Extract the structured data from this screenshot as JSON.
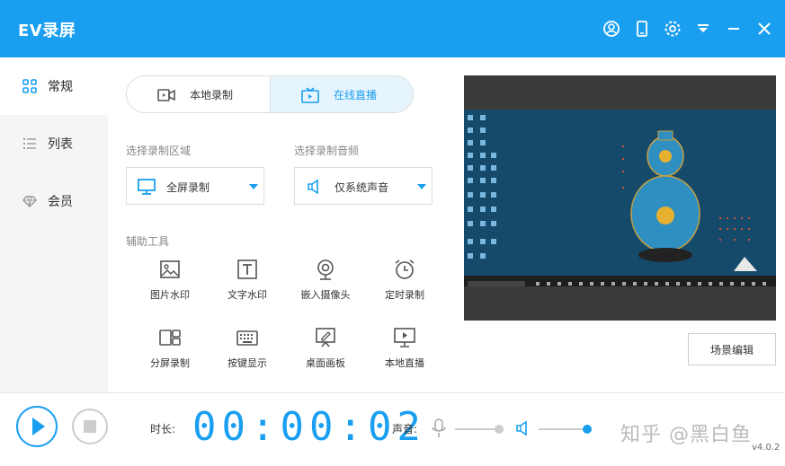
{
  "app": {
    "title": "EV录屏"
  },
  "sidebar": {
    "items": [
      {
        "label": "常规",
        "icon": "grid-icon",
        "active": true
      },
      {
        "label": "列表",
        "icon": "list-icon",
        "active": false
      },
      {
        "label": "会员",
        "icon": "diamond-icon",
        "active": false
      }
    ]
  },
  "mode": {
    "local_label": "本地录制",
    "live_label": "在线直播",
    "selected": "在线直播"
  },
  "record_area": {
    "label": "选择录制区域",
    "value": "全屏录制"
  },
  "record_audio": {
    "label": "选择录制音频",
    "value": "仅系统声音"
  },
  "tools": {
    "label": "辅助工具",
    "items": [
      {
        "label": "图片水印",
        "icon": "image-icon"
      },
      {
        "label": "文字水印",
        "icon": "text-icon"
      },
      {
        "label": "嵌入摄像头",
        "icon": "webcam-icon"
      },
      {
        "label": "定时录制",
        "icon": "alarm-clock-icon"
      },
      {
        "label": "分屏录制",
        "icon": "split-screen-icon"
      },
      {
        "label": "按键显示",
        "icon": "keyboard-icon"
      },
      {
        "label": "桌面画板",
        "icon": "easel-icon"
      },
      {
        "label": "本地直播",
        "icon": "monitor-play-icon"
      }
    ]
  },
  "preview": {
    "scene_button": "场景编辑"
  },
  "bottom": {
    "duration_label": "时长:",
    "timer": "00:00:02",
    "volume_label": "声音:",
    "mic_level": 0.9,
    "speaker_level": 1.0,
    "watermark": "知乎 @黑白鱼",
    "version": "v4.0.2"
  },
  "colors": {
    "accent": "#1a9ff0",
    "sidebar_bg": "#f5f5f5",
    "preview_bg": "#3a3a3a"
  }
}
